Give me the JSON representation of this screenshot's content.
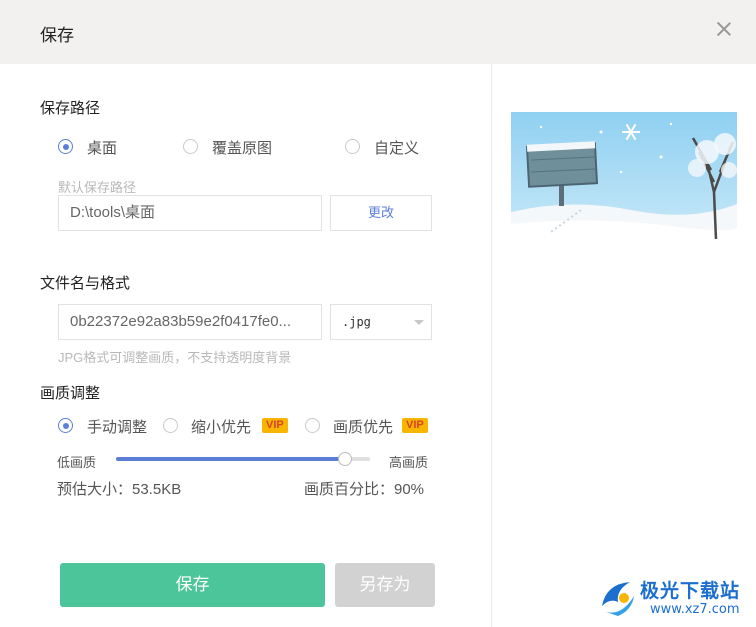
{
  "dialog": {
    "title": "保存"
  },
  "save_path": {
    "heading": "保存路径",
    "options": [
      {
        "label": "桌面",
        "checked": true
      },
      {
        "label": "覆盖原图",
        "checked": false
      },
      {
        "label": "自定义",
        "checked": false
      }
    ],
    "default_label": "默认保存路径",
    "path_value": "D:\\tools\\桌面",
    "change_button": "更改"
  },
  "file": {
    "heading": "文件名与格式",
    "filename_value": "0b22372e92a83b59e2f0417fe0...",
    "format_selected": ".jpg",
    "hint": "JPG格式可调整画质，不支持透明度背景"
  },
  "quality": {
    "heading": "画质调整",
    "modes": [
      {
        "label": "手动调整",
        "checked": true,
        "vip": false
      },
      {
        "label": "缩小优先",
        "checked": false,
        "vip": true
      },
      {
        "label": "画质优先",
        "checked": false,
        "vip": true
      }
    ],
    "vip_badge": "VIP",
    "low_label": "低画质",
    "high_label": "高画质",
    "slider_value": 0.9,
    "estimated_size": "预估大小：53.5KB",
    "quality_percent": "画质百分比：90%"
  },
  "buttons": {
    "save": "保存",
    "save_as": "另存为"
  },
  "watermark": {
    "brand": "极光下载站",
    "url": "www.xz7.com"
  },
  "colors": {
    "accent": "#5b7fd6",
    "primary_button": "#4dc59a",
    "disabled_button": "#d2d2d2",
    "vip_badge": "#f7b500",
    "titlebar": "#f3f1ef"
  }
}
